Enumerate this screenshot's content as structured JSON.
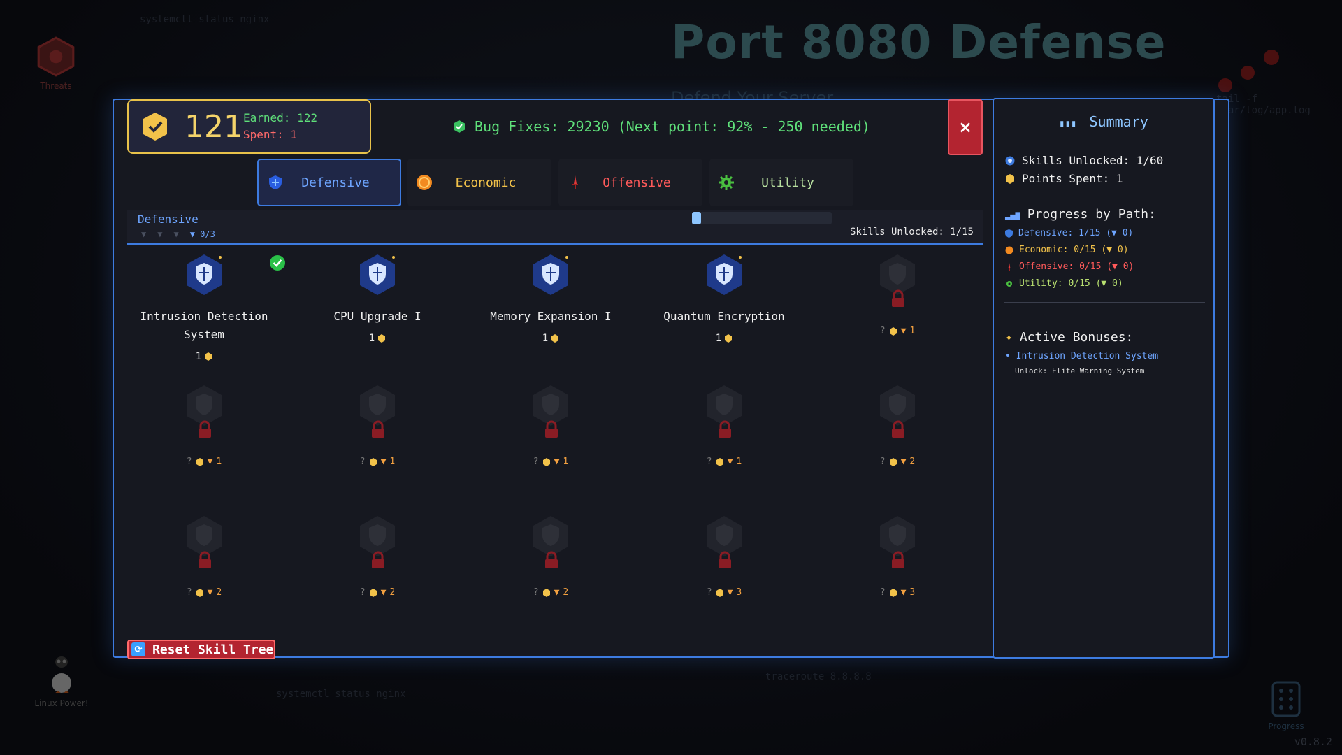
{
  "background": {
    "title": "Port 8080 Defense",
    "subtitle": "Defend Your Server",
    "threats_label": "Threats",
    "tux_label": "Linux Power!",
    "progress_label": "Progress",
    "version": "v0.8.2",
    "faint_texts": [
      "systemctl status nginx",
      "traceroute 8.8.8.8",
      "tail -f /var/log/app.log"
    ]
  },
  "points": {
    "available": "121",
    "earned": "Earned: 122",
    "spent": "Spent: 1"
  },
  "bugfix_text": "Bug Fixes: 29230 (Next point: 92% - 250 needed)",
  "close_label": "×",
  "tabs": [
    {
      "label": "Defensive",
      "icon": "shield-icon",
      "active": true
    },
    {
      "label": "Economic",
      "icon": "coin-icon",
      "active": false
    },
    {
      "label": "Offensive",
      "icon": "dagger-icon",
      "active": false
    },
    {
      "label": "Utility",
      "icon": "gear-icon",
      "active": false
    }
  ],
  "path_header": {
    "name": "Defensive",
    "tier_counter": "▼ 0/3",
    "progress_fraction": 0.067,
    "skills_unlocked": "Skills Unlocked: 1/15"
  },
  "skills_unlocked": [
    {
      "name": "Intrusion Detection System",
      "cost": "1",
      "purchased": true
    },
    {
      "name": "CPU Upgrade I",
      "cost": "1",
      "purchased": false
    },
    {
      "name": "Memory Expansion I",
      "cost": "1",
      "purchased": false
    },
    {
      "name": "Quantum Encryption",
      "cost": "1",
      "purchased": false
    }
  ],
  "skills_locked": [
    {
      "q": "?",
      "tier": "1"
    },
    {
      "q": "?",
      "tier": "1"
    },
    {
      "q": "?",
      "tier": "1"
    },
    {
      "q": "?",
      "tier": "1"
    },
    {
      "q": "?",
      "tier": "1"
    },
    {
      "q": "?",
      "tier": "2"
    },
    {
      "q": "?",
      "tier": "2"
    },
    {
      "q": "?",
      "tier": "2"
    },
    {
      "q": "?",
      "tier": "2"
    },
    {
      "q": "?",
      "tier": "3"
    },
    {
      "q": "?",
      "tier": "3"
    }
  ],
  "reset_label": "Reset Skill Tree",
  "summary": {
    "title": "Summary",
    "skills_unlocked": "Skills Unlocked: 1/60",
    "points_spent": "Points Spent: 1",
    "progress_title": "Progress by Path:",
    "paths": [
      {
        "text": "Defensive: 1/15 (▼ 0)",
        "color": "#6ea5ff"
      },
      {
        "text": "Economic: 0/15 (▼ 0)",
        "color": "#f2c24a"
      },
      {
        "text": "Offensive: 0/15 (▼ 0)",
        "color": "#ff5a5a"
      },
      {
        "text": "Utility: 0/15 (▼ 0)",
        "color": "#b8e070"
      }
    ],
    "bonuses_title": "Active Bonuses:",
    "bonus_name": "• Intrusion Detection System",
    "bonus_sub": "Unlock: Elite Warning System"
  },
  "colors": {
    "accent": "#3d7be0",
    "gold": "#f2c24a",
    "green": "#5fe07a",
    "red": "#b32430"
  }
}
